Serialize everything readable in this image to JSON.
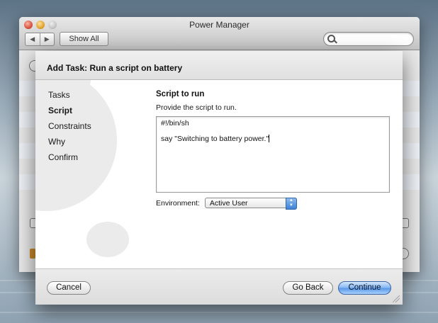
{
  "window": {
    "title": "Power Manager",
    "nav_back": "◀",
    "nav_forward": "▶",
    "show_all_label": "Show All",
    "search_placeholder": ""
  },
  "sheet": {
    "title": "Add Task: Run a script on battery",
    "steps": [
      {
        "label": "Tasks",
        "active": false
      },
      {
        "label": "Script",
        "active": true
      },
      {
        "label": "Constraints",
        "active": false
      },
      {
        "label": "Why",
        "active": false
      },
      {
        "label": "Confirm",
        "active": false
      }
    ],
    "section_title": "Script to run",
    "section_desc": "Provide the script to run.",
    "script_lines": [
      "#!/bin/sh",
      "",
      "say \"Switching to battery power.\""
    ],
    "environment_label": "Environment:",
    "environment_value": "Active User",
    "buttons": {
      "cancel": "Cancel",
      "go_back": "Go Back",
      "continue": "Continue"
    }
  },
  "colors": {
    "accent_button": "#5c9ae6",
    "sheet_background": "#ececec"
  },
  "icons": [
    "close-traffic-light",
    "minimize-traffic-light",
    "zoom-traffic-light",
    "search-icon",
    "chevron-up-down-icon",
    "resize-grip-icon"
  ]
}
